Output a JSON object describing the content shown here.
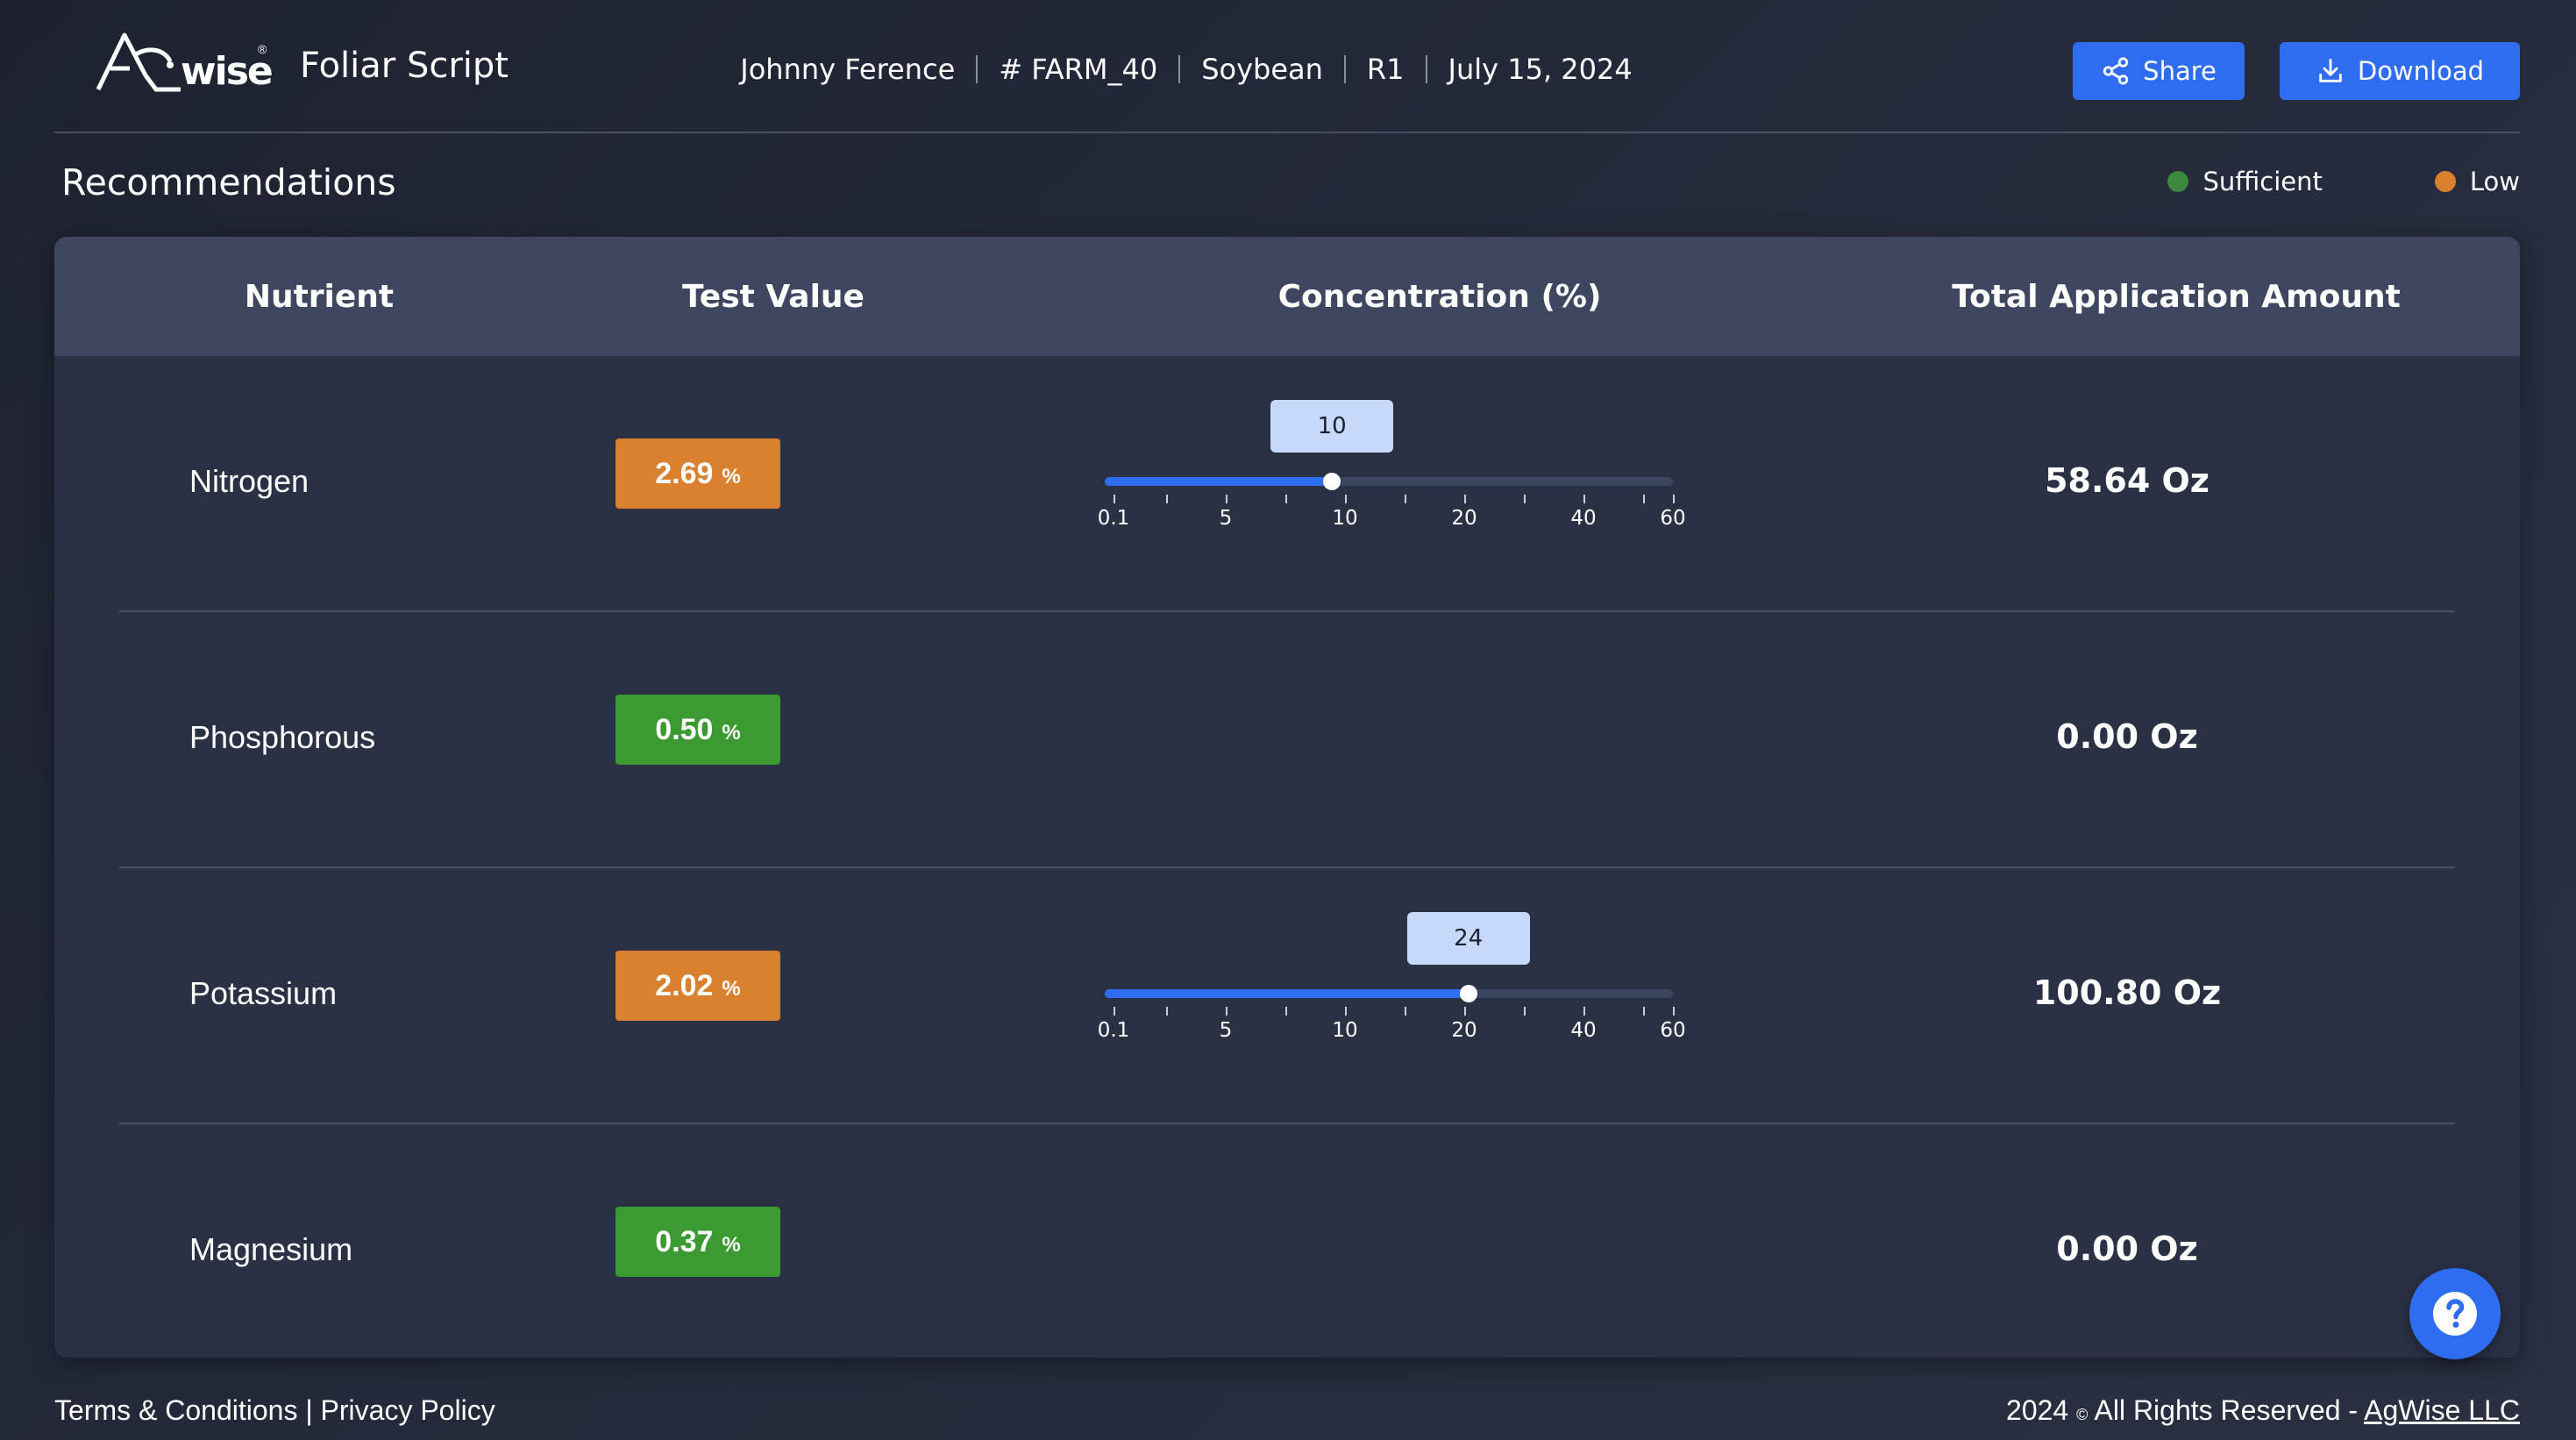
{
  "header": {
    "logo_text": "AGwise",
    "logo_mark": "®",
    "app_title": "Foliar Script",
    "meta": [
      "Johnny Ference",
      "# FARM_40",
      "Soybean",
      "R1",
      "July 15, 2024"
    ],
    "share_label": "Share",
    "download_label": "Download",
    "accent": "#2f6df0"
  },
  "section": {
    "title": "Recommendations",
    "legend": [
      {
        "label": "Sufficient",
        "color": "#3c8a3e"
      },
      {
        "label": "Low",
        "color": "#d9812f"
      }
    ]
  },
  "table": {
    "columns": [
      "Nutrient",
      "Test Value",
      "Concentration (%)",
      "Total Application Amount"
    ],
    "scale_labels": [
      "0.1",
      "5",
      "10",
      "20",
      "40",
      "60"
    ],
    "rows": [
      {
        "nutrient": "Nitrogen",
        "value": "2.69",
        "unit": "%",
        "status": "low",
        "status_color": "#d9812f",
        "concentration": "10",
        "concentration_fraction": 0.4,
        "has_slider": true,
        "amount": "58.64 Oz"
      },
      {
        "nutrient": "Phosphorous",
        "value": "0.50",
        "unit": "%",
        "status": "sufficient",
        "status_color": "#3c9a32",
        "concentration": null,
        "has_slider": false,
        "amount": "0.00 Oz"
      },
      {
        "nutrient": "Potassium",
        "value": "2.02",
        "unit": "%",
        "status": "low",
        "status_color": "#d9812f",
        "concentration": "24",
        "concentration_fraction": 0.64,
        "has_slider": true,
        "amount": "100.80 Oz"
      },
      {
        "nutrient": "Magnesium",
        "value": "0.37",
        "unit": "%",
        "status": "sufficient",
        "status_color": "#3c9a32",
        "concentration": null,
        "has_slider": false,
        "amount": "0.00 Oz"
      }
    ]
  },
  "footer": {
    "left": "Terms & Conditions | Privacy Policy",
    "right_prefix": "2024",
    "copyright_symbol": "©",
    "right_middle": "All Rights Reserved -",
    "company": "AgWise LLC"
  },
  "help_icon": "help-question-icon"
}
